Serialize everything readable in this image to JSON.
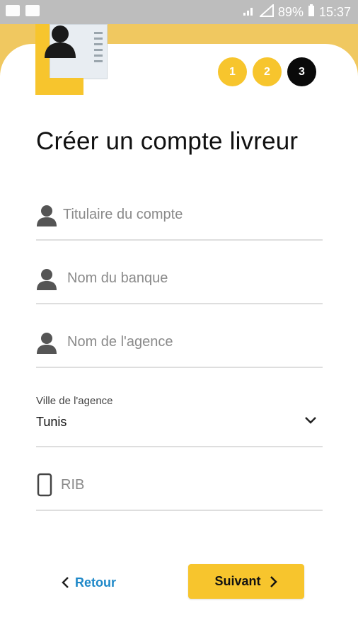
{
  "status_bar": {
    "battery": "89%",
    "time": "15:37"
  },
  "steps": [
    "1",
    "2",
    "3"
  ],
  "title": "Créer un compte livreur",
  "fields": {
    "holder": {
      "placeholder": "Titulaire du compte",
      "icon": "person-icon"
    },
    "bank": {
      "placeholder": "Nom du banque",
      "icon": "person-icon"
    },
    "agency": {
      "placeholder": "Nom de l'agence",
      "icon": "person-icon"
    },
    "city": {
      "label": "Ville de l'agence",
      "value": "Tunis",
      "icon": "chevron-down-icon"
    },
    "rib": {
      "placeholder": "RIB",
      "icon": "phone-icon"
    }
  },
  "buttons": {
    "back": "Retour",
    "next": "Suivant"
  },
  "colors": {
    "accent": "#f7c52d",
    "link": "#1e88c8",
    "active_step": "#0a0a0a"
  }
}
